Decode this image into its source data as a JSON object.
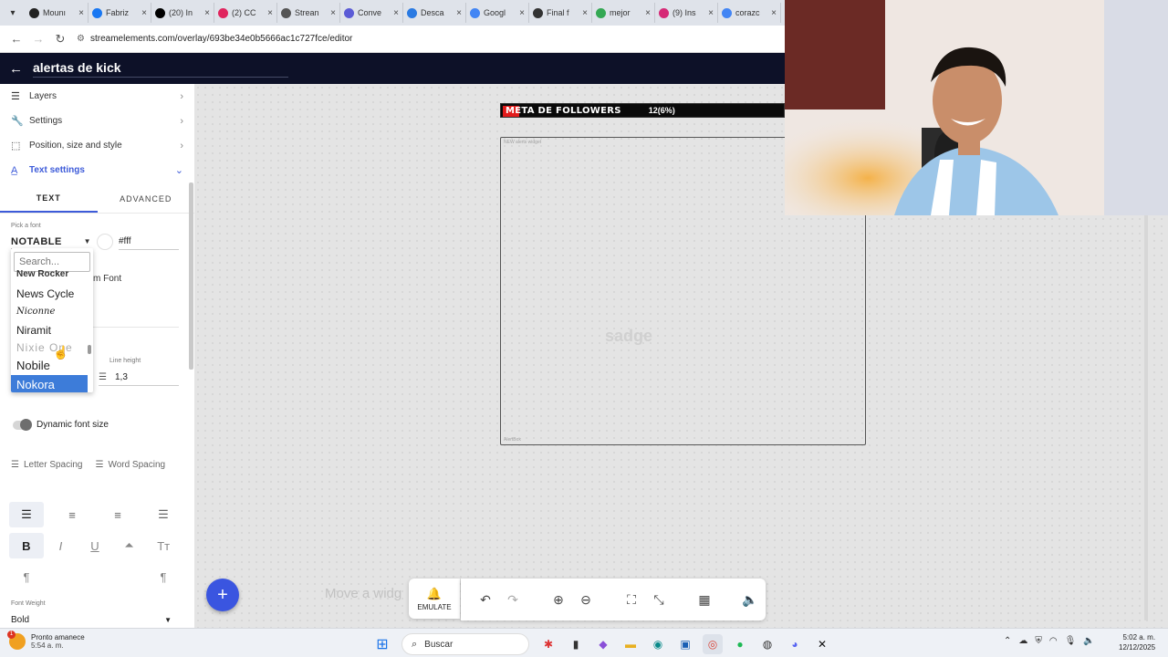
{
  "browser": {
    "tabs": [
      {
        "label": "Mounı",
        "color": "#222222"
      },
      {
        "label": "Fabriz",
        "color": "#1877f2"
      },
      {
        "label": "(20) In",
        "color": "#000000"
      },
      {
        "label": "(2) CC",
        "color": "#e0245e"
      },
      {
        "label": "Strean",
        "color": "#555555"
      },
      {
        "label": "Conve",
        "color": "#5b5bd6"
      },
      {
        "label": "Desca",
        "color": "#2a7ae2"
      },
      {
        "label": "Googl",
        "color": "#4285f4"
      },
      {
        "label": "Final f",
        "color": "#333333"
      },
      {
        "label": "mejor",
        "color": "#34a853"
      },
      {
        "label": "(9) Ins",
        "color": "#d62976"
      },
      {
        "label": "corazc",
        "color": "#4285f4"
      }
    ],
    "url": "streamelements.com/overlay/693be34e0b5666ac1c727fce/editor"
  },
  "header": {
    "title": "alertas de kick"
  },
  "sidebar": {
    "items": [
      {
        "label": "Layers",
        "icon": "hamburger-icon"
      },
      {
        "label": "Settings",
        "icon": "wrench-icon"
      },
      {
        "label": "Position, size and style",
        "icon": "position-icon"
      },
      {
        "label": "Text settings",
        "icon": "text-icon"
      }
    ],
    "tabs": [
      "TEXT",
      "ADVANCED"
    ],
    "pick_font_label": "Pick a font",
    "selected_font": "NOTABLE",
    "color_value": "#fff",
    "custom_font_text": "m Font",
    "line_height_label": "Line height",
    "line_height_value": "1,3",
    "dynamic_font_label": "Dynamic font size",
    "letter_spacing": "Letter Spacing",
    "word_spacing": "Word Spacing",
    "font_weight_label": "Font Weight",
    "font_weight_value": "Bold"
  },
  "font_dropdown": {
    "search_placeholder": "Search...",
    "cut_option": "New Rocker",
    "options": [
      "News Cycle",
      "Niconne",
      "Niramit",
      "Nixie One",
      "Nobile",
      "Nokora"
    ],
    "selected": "Nokora"
  },
  "canvas": {
    "goal_title": "META DE FOLLOWERS",
    "goal_count": "12(6%)",
    "goal_progress_percent": 6,
    "widget_tag_top": "NEW alerts widget",
    "widget_tag_bottom": "AlertBox",
    "ghost_text": "sadge",
    "move_hint": "Move a widg",
    "emulate_label": "EMULATE"
  },
  "taskbar": {
    "weather_line1": "Pronto amanece",
    "weather_line2": "5:54 a. m.",
    "weather_badge": "1",
    "search_label": "Buscar",
    "time": "5:02 a. m.",
    "date": "12/12/2025"
  }
}
